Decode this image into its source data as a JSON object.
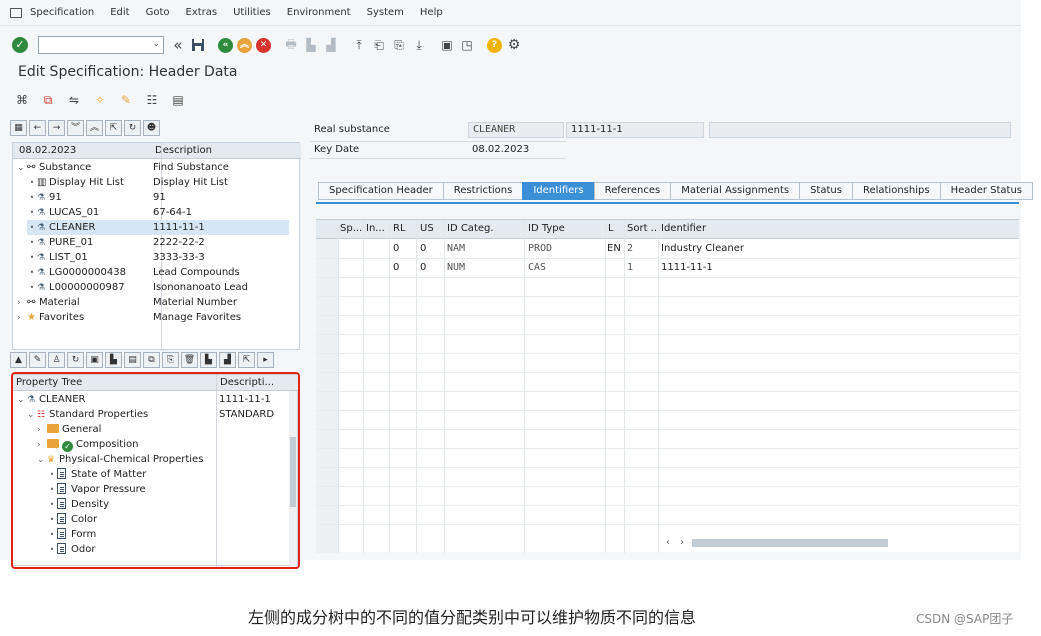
{
  "menu": [
    "Specification",
    "Edit",
    "Goto",
    "Extras",
    "Utilities",
    "Environment",
    "System",
    "Help"
  ],
  "title": "Edit Specification: Header Data",
  "hitlist": {
    "header": {
      "date": "08.02.2023",
      "description": "Description"
    },
    "rows": [
      {
        "label": "Substance",
        "desc": "Find Substance"
      },
      {
        "label": "Display Hit List",
        "desc": "Display Hit List"
      },
      {
        "label": "91",
        "desc": "91"
      },
      {
        "label": "LUCAS_01",
        "desc": "67-64-1"
      },
      {
        "label": "CLEANER",
        "desc": "1111-11-1"
      },
      {
        "label": "PURE_01",
        "desc": "2222-22-2"
      },
      {
        "label": "LIST_01",
        "desc": "3333-33-3"
      },
      {
        "label": "LG0000000438",
        "desc": "Lead Compounds"
      },
      {
        "label": "L00000000987",
        "desc": "Isononanoato Lead"
      },
      {
        "label": "Material",
        "desc": "Material Number"
      },
      {
        "label": "Favorites",
        "desc": "Manage Favorites"
      }
    ]
  },
  "property_tree": {
    "header": {
      "name": "Property Tree",
      "desc": "Descripti..."
    },
    "root": {
      "label": "CLEANER",
      "desc": "1111-11-1"
    },
    "standard": {
      "label": "Standard Properties",
      "desc": "STANDARD"
    },
    "general": "General",
    "composition": "Composition",
    "physchem": "Physical-Chemical Properties",
    "leaves": [
      "State of Matter",
      "Vapor Pressure",
      "Density",
      "Color",
      "Form",
      "Odor"
    ]
  },
  "header_fields": {
    "real_substance_label": "Real substance",
    "real_substance_value": "CLEANER",
    "real_substance_desc": "1111-11-1",
    "key_date_label": "Key Date",
    "key_date_value": "08.02.2023"
  },
  "tabs": [
    {
      "label": "Specification Header",
      "active": false
    },
    {
      "label": "Restrictions",
      "active": false
    },
    {
      "label": "Identifiers",
      "active": true
    },
    {
      "label": "References",
      "active": false
    },
    {
      "label": "Material Assignments",
      "active": false
    },
    {
      "label": "Status",
      "active": false
    },
    {
      "label": "Relationships",
      "active": false
    },
    {
      "label": "Header Status",
      "active": false
    }
  ],
  "identifiers_table": {
    "columns": [
      "Sp...",
      "In...",
      "RL",
      "US",
      "ID Categ.",
      "ID Type",
      "L",
      "Sort ...",
      "Identifier"
    ],
    "rows": [
      [
        "",
        "",
        "0",
        "0",
        "NAM",
        "PROD",
        "EN",
        "2",
        "Industry Cleaner"
      ],
      [
        "",
        "",
        "0",
        "0",
        "NUM",
        "CAS",
        "",
        "1",
        "1111-11-1"
      ]
    ]
  },
  "caption": "左侧的成分树中的不同的值分配类别中可以维护物质不同的信息",
  "watermark": "CSDN @SAP团子",
  "colors": {
    "accent": "#3b8fd6",
    "highlight": "#e2231a",
    "ok": "#2e8b3e"
  }
}
